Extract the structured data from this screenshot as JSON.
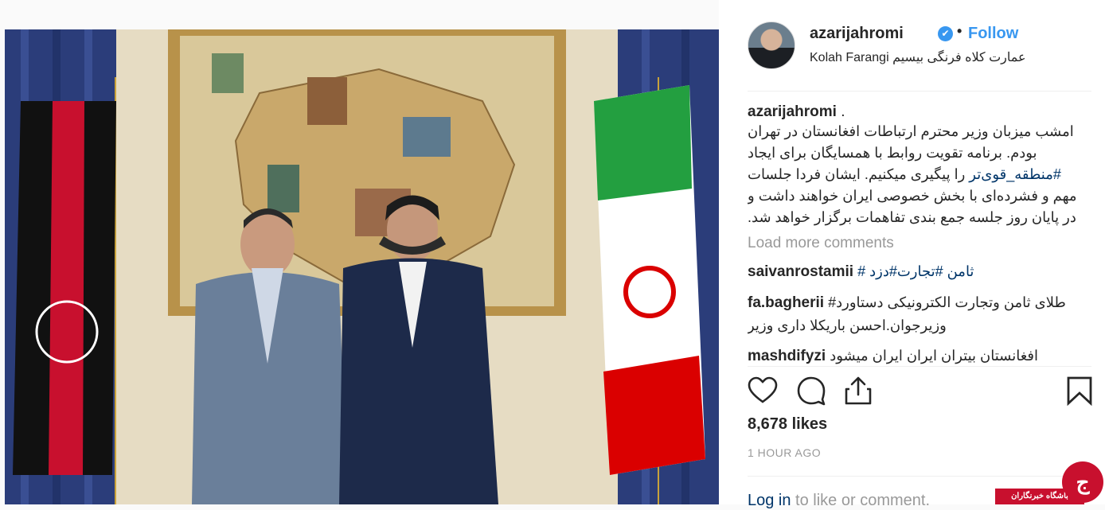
{
  "post": {
    "username": "azarijahromi",
    "verified_mark": "✔",
    "dot": "•",
    "follow_label": "Follow",
    "location": "Kolah Farangi عمارت کلاه فرنگی بیسیم"
  },
  "caption": {
    "username": "azarijahromi",
    "username_suffix": " .",
    "line1": "امشب میزبان وزیر محترم ارتباطات افغانستان در تهران",
    "line2": "بودم. برنامه تقویت روابط با همسایگان برای ایجاد",
    "hashtag": "#منطقه_قوی‌تر",
    "line3_rest": " را پیگیری میکنیم. ایشان فردا جلسات",
    "line4": "مهم و فشرده‌ای با بخش خصوصی ایران خواهند داشت و",
    "line5": "در پایان روز جلسه جمع بندی تفاهمات برگزار خواهد شد."
  },
  "load_more": "Load more comments",
  "comments": [
    {
      "user": "saivanrostamii",
      "text": "# ثامن  #تجارت#دزد"
    },
    {
      "user": "fa.bagherii",
      "text": "#طلای ثامن وتجارت الکترونیکی دستاورد وزیرجوان.احسن باریکلا داری وزیر"
    },
    {
      "user": "mashdifyzi",
      "text": "افغانستان بیتران ایران ایران میشود"
    }
  ],
  "icons": [
    "heart-icon",
    "comment-icon",
    "share-icon",
    "bookmark-icon"
  ],
  "likes": "8,678 likes",
  "time_ago": "1 HOUR AGO",
  "login": {
    "link": "Log in",
    "rest": " to like or comment."
  },
  "watermark": {
    "bar_text": "باشگاه خبرنگاران",
    "logo_text": "ج"
  },
  "colors": {
    "link": "#003569",
    "follow": "#3897f0",
    "muted": "#999999",
    "watermark": "#c8102e"
  }
}
